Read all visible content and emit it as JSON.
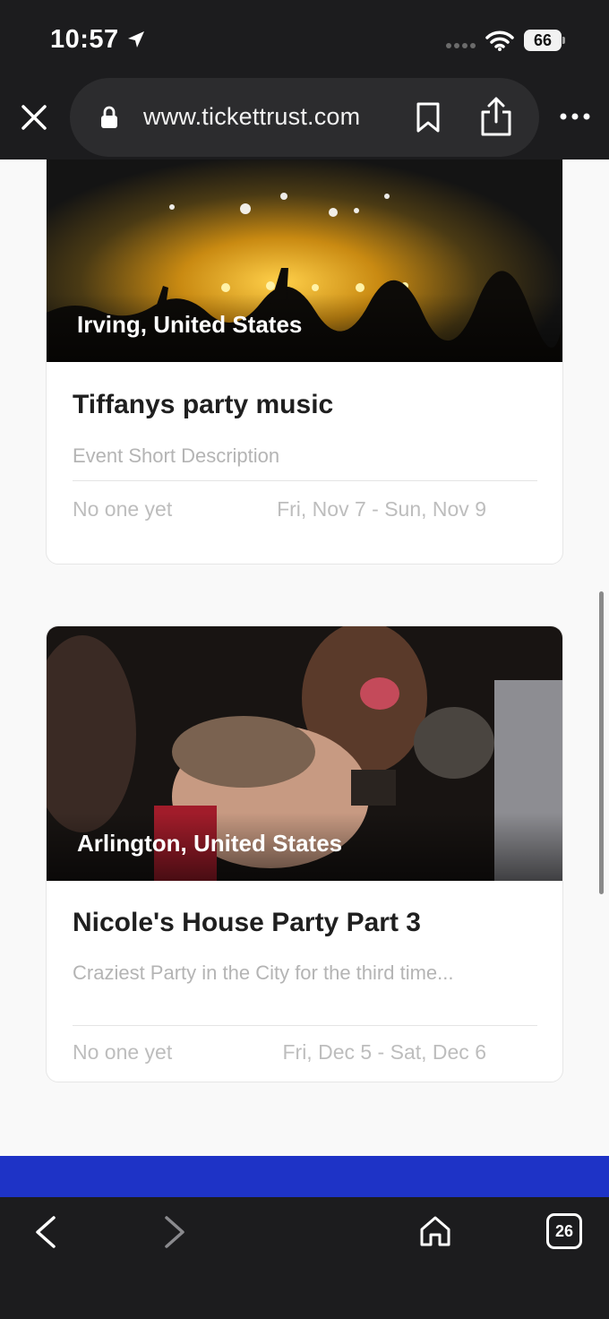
{
  "status_bar": {
    "time": "10:57",
    "battery_level": "66",
    "icons": [
      "location-arrow-icon",
      "signal-dots-icon",
      "wifi-icon",
      "battery-icon"
    ]
  },
  "browser": {
    "url": "www.tickettrust.com",
    "toolbar_icons": [
      "close-icon",
      "lock-icon",
      "bookmark-icon",
      "share-icon",
      "more-icon"
    ],
    "bottom_icons": [
      "back-icon",
      "forward-icon",
      "home-icon",
      "tabs-icon"
    ],
    "tab_count": "26"
  },
  "events": [
    {
      "location": "Irving, United States",
      "title": "Tiffanys party music",
      "description": "Event Short Description",
      "attendees": "No one yet",
      "dates": "Fri, Nov 7 - Sun, Nov 9"
    },
    {
      "location": "Arlington, United States",
      "title": "Nicole's House Party Part 3",
      "description": "Craziest Party in the City for the third time...",
      "attendees": "No one yet",
      "dates": "Fri, Dec 5 - Sat, Dec 6"
    }
  ],
  "colors": {
    "chrome": "#1c1c1e",
    "url_pill": "#2c2c2e",
    "page_bg": "#f9f9f9",
    "accent_band": "#1e33c6",
    "title_text": "#1f1f1f",
    "muted_text": "#bdbdbd"
  }
}
